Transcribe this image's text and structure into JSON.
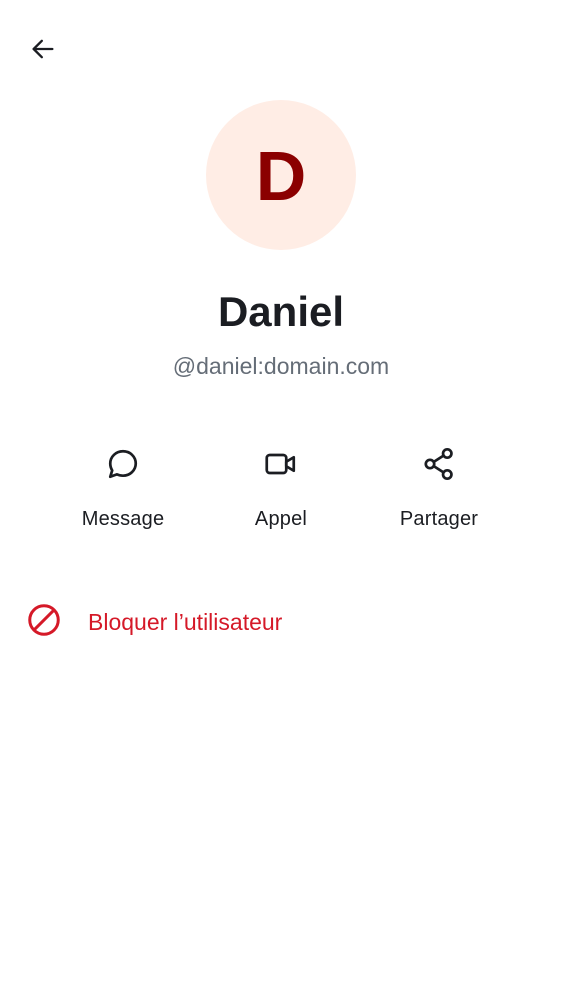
{
  "header": {
    "back_icon": "arrow-left-icon"
  },
  "profile": {
    "avatar_letter": "D",
    "avatar_bg": "#ffede5",
    "avatar_fg": "#8b0000",
    "name": "Daniel",
    "handle": "@daniel:domain.com"
  },
  "actions": [
    {
      "label": "Message",
      "icon": "chat-bubble-icon"
    },
    {
      "label": "Appel",
      "icon": "video-camera-icon"
    },
    {
      "label": "Partager",
      "icon": "share-icon"
    }
  ],
  "block": {
    "label": "Bloquer l’utilisateur",
    "icon": "block-icon",
    "color": "#d51928"
  }
}
